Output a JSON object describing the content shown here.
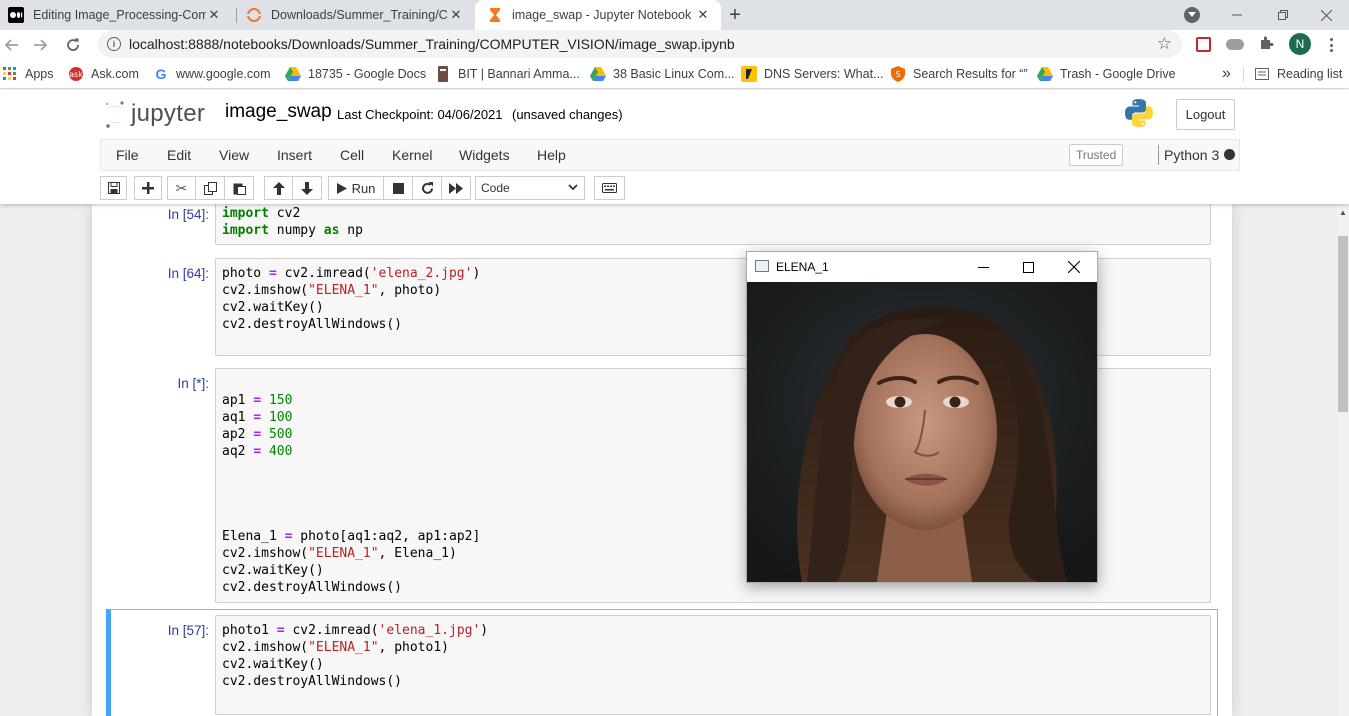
{
  "browser": {
    "tabs": [
      {
        "title": "Editing Image_Processing-Comp",
        "favicon": "medium-icon",
        "active": false
      },
      {
        "title": "Downloads/Summer_Training/CO",
        "favicon": "jupyter-icon",
        "active": false
      },
      {
        "title": "image_swap - Jupyter Notebook",
        "favicon": "hourglass-icon",
        "active": true
      }
    ],
    "new_tab_label": "+",
    "url": "localhost:8888/notebooks/Downloads/Summer_Training/COMPUTER_VISION/image_swap.ipynb",
    "profile_initial": "N",
    "bookmarks": [
      {
        "label": "Apps",
        "icon": "apps-grid-icon"
      },
      {
        "label": "Ask.com",
        "icon": "ask-icon"
      },
      {
        "label": "www.google.com",
        "icon": "google-icon"
      },
      {
        "label": "18735 - Google Docs",
        "icon": "drive-icon"
      },
      {
        "label": "BIT | Bannari Amma...",
        "icon": "bit-icon"
      },
      {
        "label": "38 Basic Linux Com...",
        "icon": "drive-icon"
      },
      {
        "label": "DNS Servers: What...",
        "icon": "dns-icon"
      },
      {
        "label": "Search Results for “”",
        "icon": "shield-icon"
      },
      {
        "label": "Trash - Google Drive",
        "icon": "drive-icon"
      }
    ],
    "bookmarks_overflow": "»",
    "reading_list": "Reading list"
  },
  "jupyter": {
    "logo_text": "jupyter",
    "notebook_name": "image_swap",
    "checkpoint": "Last Checkpoint: 04/06/2021",
    "unsaved": "(unsaved changes)",
    "logout_label": "Logout",
    "menus": [
      "File",
      "Edit",
      "View",
      "Insert",
      "Cell",
      "Kernel",
      "Widgets",
      "Help"
    ],
    "trusted_label": "Trusted",
    "kernel_name": "Python 3",
    "run_label": "Run",
    "cell_type": "Code"
  },
  "cells": [
    {
      "prompt": "In [54]:",
      "lines": [
        "import cv2",
        "import numpy as np"
      ]
    },
    {
      "prompt": "In [64]:",
      "lines": [
        "photo = cv2.imread('elena_2.jpg')",
        "cv2.imshow(\"ELENA_1\", photo)",
        "cv2.waitKey()",
        "cv2.destroyAllWindows()"
      ]
    },
    {
      "prompt": "In [*]:",
      "lines": [
        "ap1 = 150",
        "aq1 = 100",
        "ap2 = 500",
        "aq2 = 400",
        "Elena_1 = photo[aq1:aq2, ap1:ap2]",
        "cv2.imshow(\"ELENA_1\", Elena_1)",
        "cv2.waitKey()",
        "cv2.destroyAllWindows()"
      ]
    },
    {
      "prompt": "In [57]:",
      "lines": [
        "photo1 = cv2.imread('elena_1.jpg')",
        "cv2.imshow(\"ELENA_1\", photo1)",
        "cv2.waitKey()",
        "cv2.destroyAllWindows()"
      ]
    }
  ],
  "cv_window": {
    "title": "ELENA_1"
  },
  "colors": {
    "tabstrip": "#dee1e6",
    "selected_cell_border": "#42a5f5",
    "prompt": "#303f9f",
    "profile_avatar": "#1e6b4f"
  }
}
